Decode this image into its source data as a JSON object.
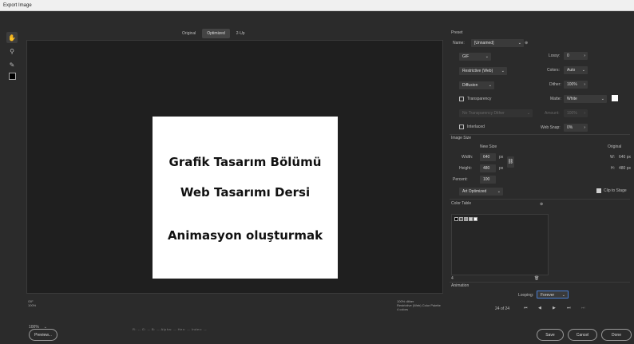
{
  "window": {
    "title": "Export Image"
  },
  "tools": [
    {
      "name": "hand-tool-icon",
      "glyph": "✋"
    },
    {
      "name": "zoom-tool-icon",
      "glyph": "🔍"
    },
    {
      "name": "eyedropper-tool-icon",
      "glyph": "✎"
    }
  ],
  "view_tabs": [
    "Original",
    "Optimized",
    "2-Up"
  ],
  "artboard": {
    "line1": "Grafik Tasarım Bölümü",
    "line2": "Web Tasarımı Dersi",
    "line3": "Animasyon oluşturmak"
  },
  "info_left": [
    "GIF",
    "100%"
  ],
  "info_right": [
    "100% dither",
    "Restrictive (Web) Color Palette",
    "4 colors"
  ],
  "bottom": {
    "zoom": "100%",
    "pixel_info": "R: -- G: -- B: -- Alpha: -- Hex: -- Index: --",
    "preview_label": "Preview...",
    "save_label": "Save",
    "cancel_label": "Cancel",
    "done_label": "Done"
  },
  "preset": {
    "section": "Preset",
    "name_label": "Name:",
    "name_value": "[Unnamed]",
    "format": "GIF",
    "lossy_label": "Lossy:",
    "lossy_value": "0",
    "reduction": "Restrictive (Web)",
    "colors_label": "Colors:",
    "colors_value": "Auto",
    "dither_algo": "Diffusion",
    "dither_label": "Dither:",
    "dither_value": "100%",
    "transparency_label": "Transparency",
    "matte_label": "Matte:",
    "matte_value": "White",
    "transparency_dither": "No Transparency Dither",
    "amount_label": "Amount:",
    "amount_value": "100%",
    "interlaced_label": "Interlaced",
    "websnap_label": "Web Snap:",
    "websnap_value": "0%"
  },
  "image_size": {
    "section": "Image Size",
    "new_size_label": "New Size",
    "original_label": "Original",
    "width_label": "Width:",
    "width_value": "640",
    "height_label": "Height:",
    "height_value": "480",
    "unit": "px",
    "percent_label": "Percent:",
    "percent_value": "100",
    "quality": "Art Optimized",
    "orig_w_label": "W:",
    "orig_w_value": "640 px",
    "orig_h_label": "H:",
    "orig_h_value": "480 px",
    "clip_label": "Clip to Stage"
  },
  "color_table": {
    "section": "Color Table",
    "count": "4"
  },
  "animation": {
    "section": "Animation",
    "looping_label": "Looping:",
    "looping_value": "Forever",
    "frame_label": "24 of 24"
  }
}
